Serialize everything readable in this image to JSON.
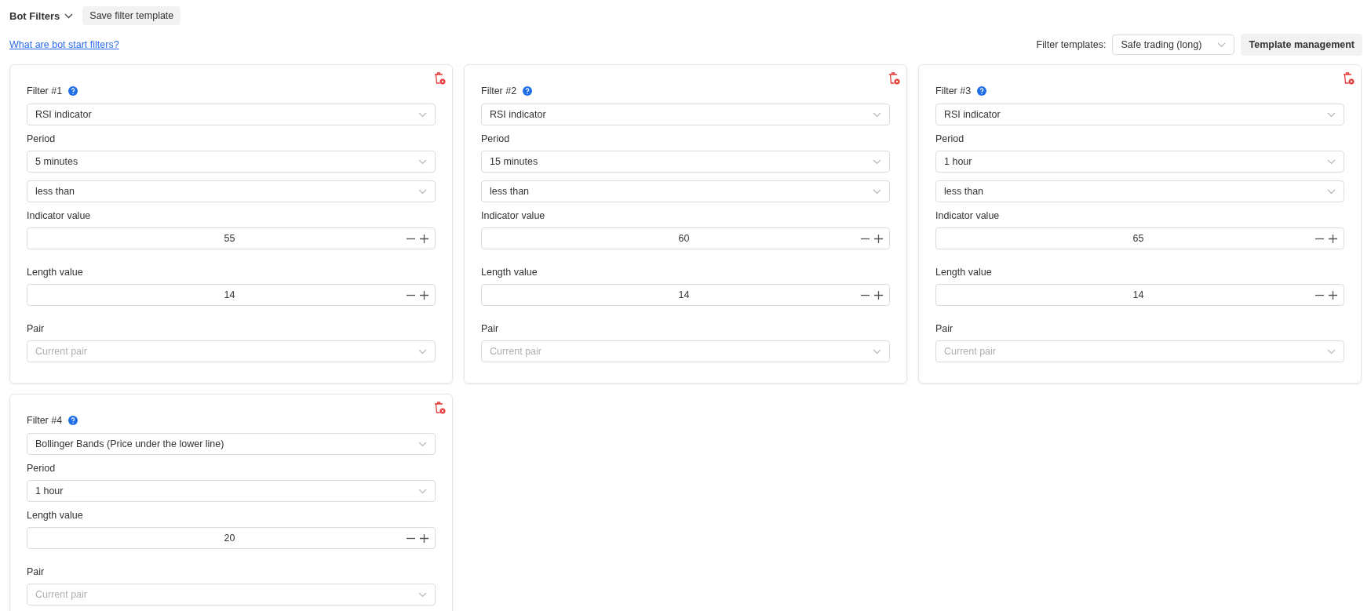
{
  "header": {
    "title": "Bot Filters",
    "save_button": "Save filter template",
    "help_link": "What are bot start filters?",
    "templates_label": "Filter templates:",
    "template_select": "Safe trading (long)",
    "management_button": "Template management"
  },
  "filters": [
    {
      "title": "Filter #1",
      "fields": [
        {
          "kind": "select",
          "value": "RSI indicator"
        },
        {
          "kind": "select",
          "label": "Period",
          "value": "5 minutes"
        },
        {
          "kind": "select",
          "value": "less than"
        },
        {
          "kind": "number",
          "label": "Indicator value",
          "value": "55"
        },
        {
          "kind": "number",
          "label": "Length value",
          "value": "14"
        },
        {
          "kind": "select",
          "label": "Pair",
          "placeholder": "Current pair"
        }
      ]
    },
    {
      "title": "Filter #2",
      "fields": [
        {
          "kind": "select",
          "value": "RSI indicator"
        },
        {
          "kind": "select",
          "label": "Period",
          "value": "15 minutes"
        },
        {
          "kind": "select",
          "value": "less than"
        },
        {
          "kind": "number",
          "label": "Indicator value",
          "value": "60"
        },
        {
          "kind": "number",
          "label": "Length value",
          "value": "14"
        },
        {
          "kind": "select",
          "label": "Pair",
          "placeholder": "Current pair"
        }
      ]
    },
    {
      "title": "Filter #3",
      "fields": [
        {
          "kind": "select",
          "value": "RSI indicator"
        },
        {
          "kind": "select",
          "label": "Period",
          "value": "1 hour"
        },
        {
          "kind": "select",
          "value": "less than"
        },
        {
          "kind": "number",
          "label": "Indicator value",
          "value": "65"
        },
        {
          "kind": "number",
          "label": "Length value",
          "value": "14"
        },
        {
          "kind": "select",
          "label": "Pair",
          "placeholder": "Current pair"
        }
      ]
    },
    {
      "title": "Filter #4",
      "fields": [
        {
          "kind": "select",
          "value": "Bollinger Bands (Price under the lower line)"
        },
        {
          "kind": "select",
          "label": "Period",
          "value": "1 hour"
        },
        {
          "kind": "number",
          "label": "Length value",
          "value": "20"
        },
        {
          "kind": "select",
          "label": "Pair",
          "placeholder": "Current pair"
        }
      ]
    }
  ]
}
